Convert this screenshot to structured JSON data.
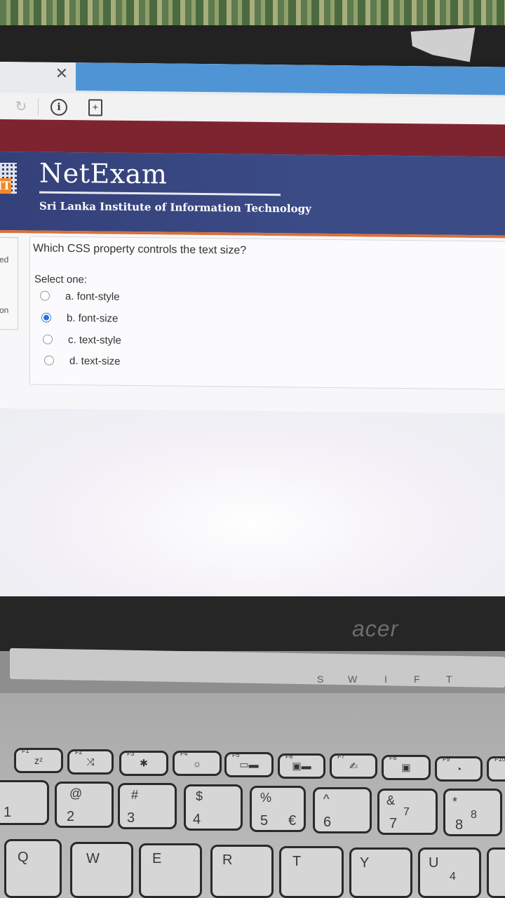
{
  "browser": {
    "close_glyph": "✕",
    "reload_icon": "refresh-icon",
    "info_glyph": "i",
    "page_glyph": "+"
  },
  "header": {
    "logo_text": "IT",
    "title": "NetExam",
    "subtitle": "Sri Lanka Institute of Information Technology"
  },
  "sidebar_stub": {
    "line1": "ed",
    "line2": "on"
  },
  "question": {
    "text": "Which CSS property controls the text size?",
    "select_label": "Select one:",
    "options": [
      {
        "label": "a. font-style",
        "selected": false
      },
      {
        "label": "b. font-size",
        "selected": true
      },
      {
        "label": "c. text-style",
        "selected": false
      },
      {
        "label": "d. text-size",
        "selected": false
      }
    ]
  },
  "laptop": {
    "brand": "acer",
    "sticker_letters": [
      "S",
      "W",
      "I",
      "F",
      "T"
    ],
    "fn_row": [
      {
        "num": "F1",
        "glyph": "zᶻ"
      },
      {
        "num": "F2",
        "glyph": "⤨"
      },
      {
        "num": "F3",
        "glyph": "✱"
      },
      {
        "num": "F4",
        "glyph": "☼"
      },
      {
        "num": "F5",
        "glyph": "▭▬"
      },
      {
        "num": "F6",
        "glyph": "▣▬"
      },
      {
        "num": "F7",
        "glyph": "✍"
      },
      {
        "num": "F8",
        "glyph": "▣"
      },
      {
        "num": "F9",
        "glyph": "◔"
      },
      {
        "num": "F10",
        "glyph": ""
      }
    ],
    "number_row": [
      {
        "top": "",
        "bottom": "1"
      },
      {
        "top": "@",
        "bottom": "2"
      },
      {
        "top": "#",
        "bottom": "3"
      },
      {
        "top": "$",
        "bottom": "4"
      },
      {
        "top": "%",
        "bottom": "5",
        "extra": "€"
      },
      {
        "top": "^",
        "bottom": "6"
      },
      {
        "top": "&",
        "bottom": "7",
        "extra": "7"
      },
      {
        "top": "*",
        "bottom": "8",
        "extra": "8"
      }
    ],
    "letter_row": [
      "Q",
      "W",
      "E",
      "R",
      "T",
      "Y",
      "U"
    ],
    "letter_row_extra": "4"
  }
}
